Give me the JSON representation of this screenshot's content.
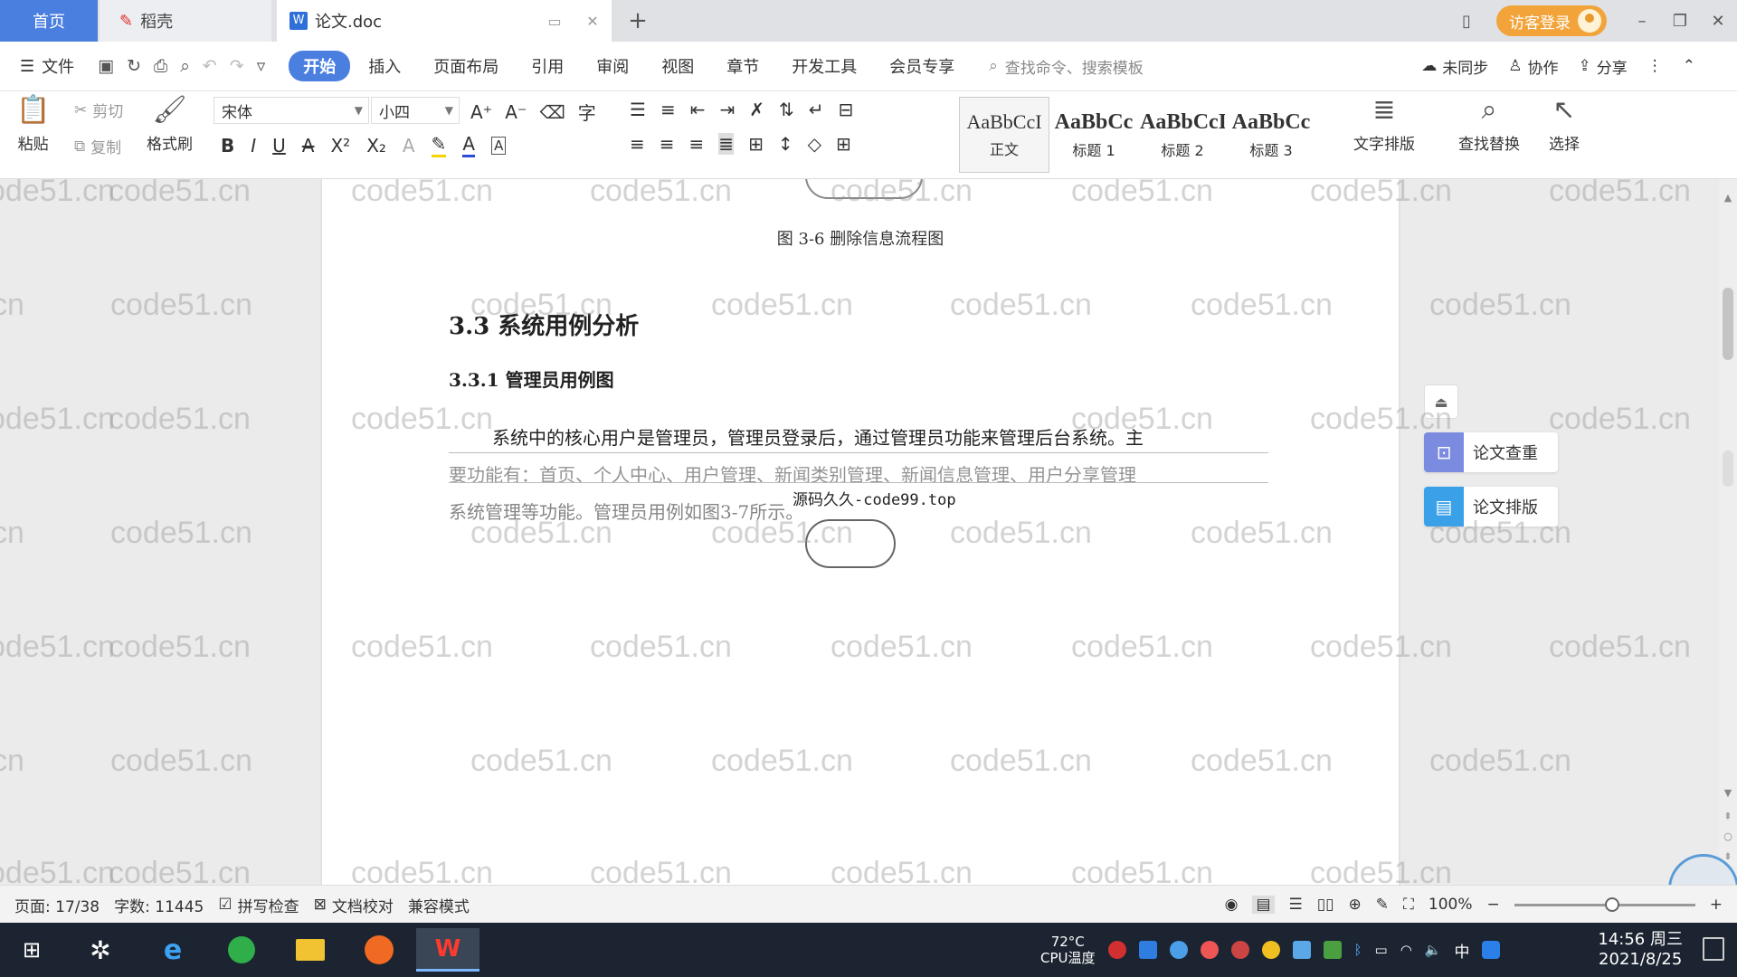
{
  "tabs": {
    "home": "首页",
    "daoke": "稻壳",
    "doc": "论文.doc",
    "visitor_login": "访客登录"
  },
  "menu": {
    "file": "文件",
    "tabs": [
      "开始",
      "插入",
      "页面布局",
      "引用",
      "审阅",
      "视图",
      "章节",
      "开发工具",
      "会员专享"
    ],
    "search_placeholder": "查找命令、搜索模板",
    "sync": "未同步",
    "collab": "协作",
    "share": "分享"
  },
  "ribbon": {
    "paste": "粘贴",
    "cut": "剪切",
    "copy": "复制",
    "format_painter": "格式刷",
    "font_name": "宋体",
    "font_size": "小四",
    "styles": [
      {
        "sample": "AaBbCcI",
        "name": "正文"
      },
      {
        "sample": "AaBbCc",
        "name": "标题 1"
      },
      {
        "sample": "AaBbCcI",
        "name": "标题 2"
      },
      {
        "sample": "AaBbCc",
        "name": "标题 3"
      }
    ],
    "text_layout": "文字排版",
    "find_replace": "查找替换",
    "select": "选择"
  },
  "document": {
    "caption": "图 3-6  删除信息流程图",
    "section_title": "3.3 系统用例分析",
    "subsection_title": "3.3.1 管理员用例图",
    "paragraph_line1": "系统中的核心用户是管理员，管理员登录后，通过管理员功能来管理后台系统。主",
    "paragraph_line2": "要功能有：首页、个人中心、用户管理、新闻类别管理、新闻信息管理、用户分享管理",
    "paragraph_line3": "系统管理等功能。管理员用例如图3-7所示。",
    "source_overlay": "源码久久-code99.top",
    "watermark": "code51.cn"
  },
  "side_panel": {
    "check": "论文查重",
    "layout": "论文排版"
  },
  "status": {
    "page": "页面: 17/38",
    "words": "字数: 11445",
    "spell": "拼写检查",
    "proof": "文档校对",
    "compat": "兼容模式",
    "zoom": "100%"
  },
  "taskbar": {
    "temp": "72°C",
    "cpu": "CPU温度",
    "ime": "中",
    "time": "14:56 周三",
    "date": "2021/8/25"
  }
}
